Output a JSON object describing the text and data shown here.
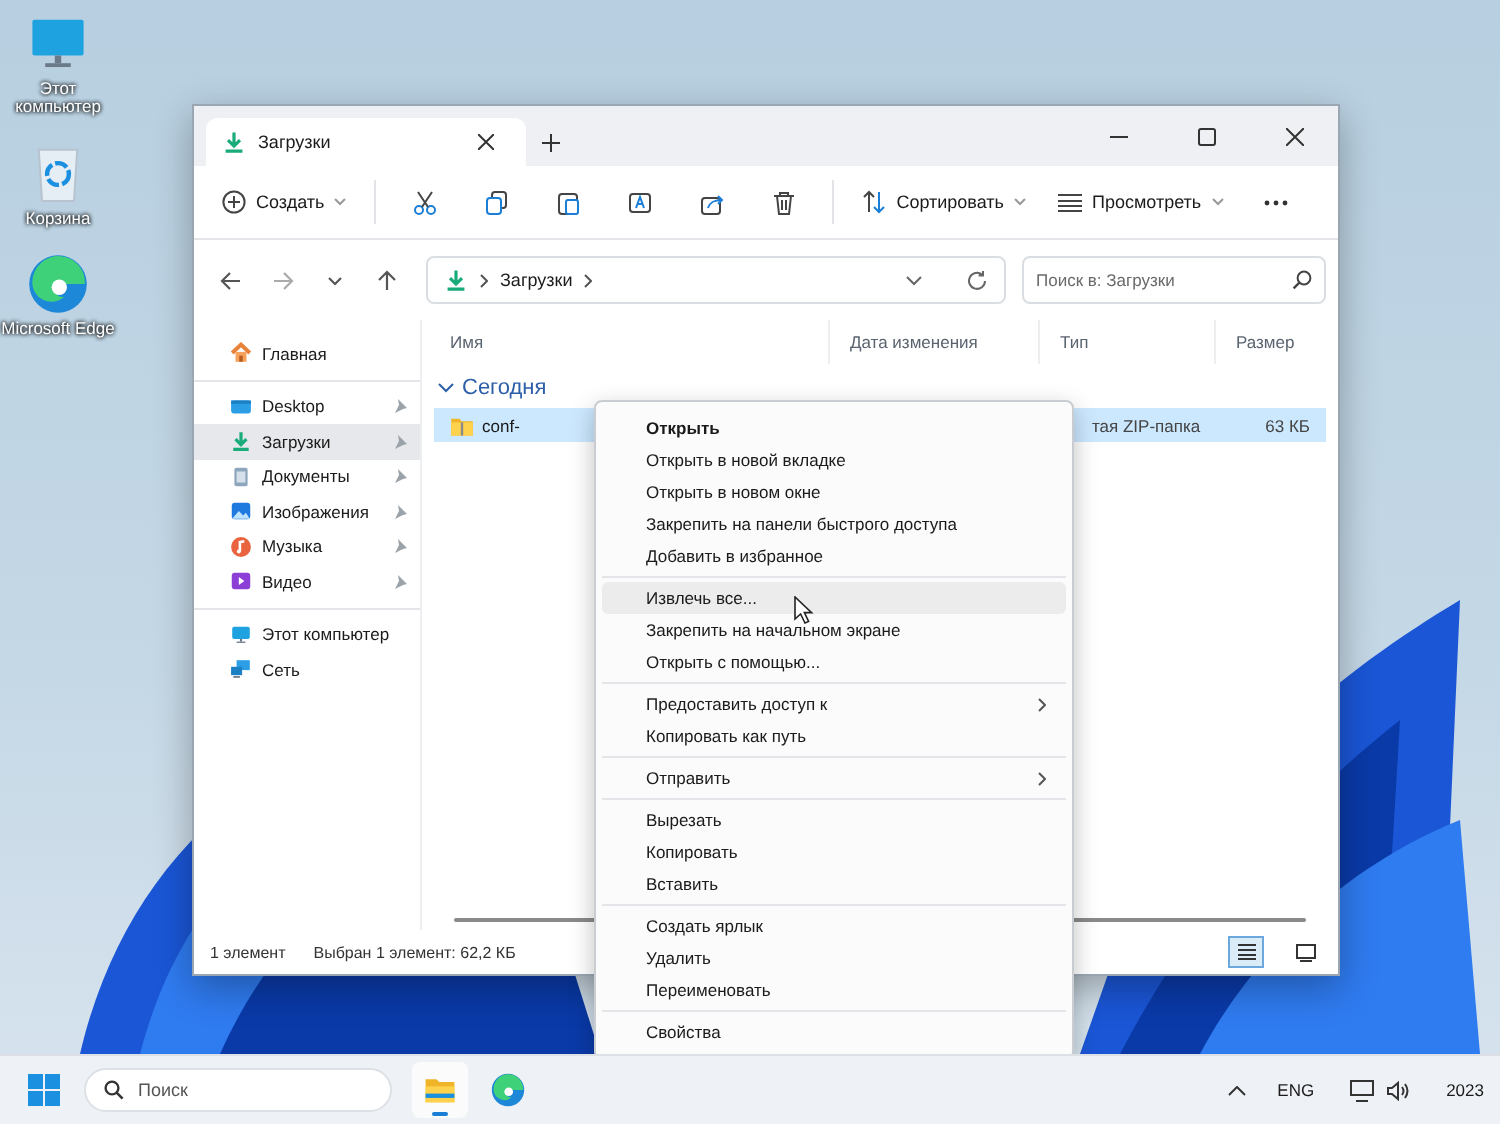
{
  "desktop_icons": [
    {
      "kind": "computer",
      "label": "Этот компьютер"
    },
    {
      "kind": "recycle",
      "label": "Корзина"
    },
    {
      "kind": "edge",
      "label": "Microsoft Edge"
    }
  ],
  "window": {
    "tabs": [
      {
        "label": "Загрузки",
        "selected": true
      }
    ],
    "toolbar": {
      "create": "Создать",
      "sort": "Сортировать",
      "view": "Просмотреть"
    },
    "address": {
      "crumb": "Загрузки"
    },
    "search": {
      "placeholder": "Поиск в: Загрузки"
    },
    "sidebar": {
      "groups": [
        [
          {
            "kind": "home",
            "label": "Главная",
            "pinned": false,
            "selected": false
          }
        ],
        [
          {
            "kind": "desktop",
            "label": "Desktop",
            "pinned": true,
            "selected": false
          },
          {
            "kind": "downloads",
            "label": "Загрузки",
            "pinned": true,
            "selected": true
          },
          {
            "kind": "documents",
            "label": "Документы",
            "pinned": true,
            "selected": false
          },
          {
            "kind": "pictures",
            "label": "Изображения",
            "pinned": true,
            "selected": false
          },
          {
            "kind": "music",
            "label": "Музыка",
            "pinned": true,
            "selected": false
          },
          {
            "kind": "video",
            "label": "Видео",
            "pinned": true,
            "selected": false
          }
        ],
        [
          {
            "kind": "computer",
            "label": "Этот компьютер",
            "pinned": false,
            "selected": false
          },
          {
            "kind": "network",
            "label": "Сеть",
            "pinned": false,
            "selected": false
          }
        ]
      ]
    },
    "columns": [
      "Имя",
      "Дата изменения",
      "Тип",
      "Размер"
    ],
    "group": {
      "label": "Сегодня",
      "expanded": true
    },
    "files": [
      {
        "name": "conf-",
        "type": "тая ZIP-папка",
        "size": "63 КБ",
        "selected": true
      }
    ],
    "status_bar": {
      "count": "1 элемент",
      "selection": "Выбран 1 элемент: 62,2 КБ"
    }
  },
  "context_menu": {
    "groups": [
      [
        {
          "label": "Открыть",
          "emphasized": true,
          "selected": false,
          "submenu": false
        },
        {
          "label": "Открыть в новой вкладке",
          "emphasized": false,
          "selected": false,
          "submenu": false
        },
        {
          "label": "Открыть в новом окне",
          "emphasized": false,
          "selected": false,
          "submenu": false
        },
        {
          "label": "Закрепить на панели быстрого доступа",
          "emphasized": false,
          "selected": false,
          "submenu": false
        },
        {
          "label": "Добавить в избранное",
          "emphasized": false,
          "selected": false,
          "submenu": false
        }
      ],
      [
        {
          "label": "Извлечь все...",
          "emphasized": false,
          "selected": true,
          "submenu": false
        },
        {
          "label": "Закрепить на начальном экране",
          "emphasized": false,
          "selected": false,
          "submenu": false
        },
        {
          "label": "Открыть с помощью...",
          "emphasized": false,
          "selected": false,
          "submenu": false
        }
      ],
      [
        {
          "label": "Предоставить доступ к",
          "emphasized": false,
          "selected": false,
          "submenu": true
        },
        {
          "label": "Копировать как путь",
          "emphasized": false,
          "selected": false,
          "submenu": false
        }
      ],
      [
        {
          "label": "Отправить",
          "emphasized": false,
          "selected": false,
          "submenu": true
        }
      ],
      [
        {
          "label": "Вырезать",
          "emphasized": false,
          "selected": false,
          "submenu": false
        },
        {
          "label": "Копировать",
          "emphasized": false,
          "selected": false,
          "submenu": false
        },
        {
          "label": "Вставить",
          "emphasized": false,
          "selected": false,
          "submenu": false
        }
      ],
      [
        {
          "label": "Создать ярлык",
          "emphasized": false,
          "selected": false,
          "submenu": false
        },
        {
          "label": "Удалить",
          "emphasized": false,
          "selected": false,
          "submenu": false
        },
        {
          "label": "Переименовать",
          "emphasized": false,
          "selected": false,
          "submenu": false
        }
      ],
      [
        {
          "label": "Свойства",
          "emphasized": false,
          "selected": false,
          "submenu": false
        }
      ]
    ]
  },
  "taskbar": {
    "search": {
      "placeholder": "Поиск"
    },
    "apps": [
      {
        "kind": "explorer",
        "selected": true
      },
      {
        "kind": "edge",
        "selected": false
      }
    ],
    "language": "ENG",
    "year": "2023"
  }
}
